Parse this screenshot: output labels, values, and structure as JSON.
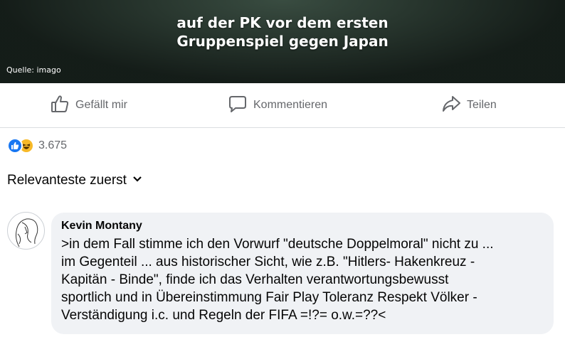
{
  "post_image": {
    "caption_line1": "auf der PK vor dem ersten",
    "caption_line2": "Gruppenspiel gegen Japan",
    "source": "Quelle: imago"
  },
  "actions": {
    "like": "Gefällt mir",
    "comment": "Kommentieren",
    "share": "Teilen"
  },
  "reactions": {
    "count": "3.675",
    "types": [
      "like",
      "haha"
    ]
  },
  "sort": {
    "label": "Relevanteste zuerst"
  },
  "comment": {
    "author": "Kevin Montany",
    "text": ">in dem Fall stimme ich den Vorwurf \"deutsche Doppelmoral\" nicht zu ...\nim Gegenteil ... aus historischer Sicht, wie z.B. \"Hitlers- Hakenkreuz -\nKapitän - Binde\", finde ich das Verhalten verantwortungsbewusst\nsportlich und in Übereinstimmung Fair Play Toleranz Respekt Völker -\nVerständigung i.c. und Regeln der FIFA =!?= o.w.=??<"
  },
  "colors": {
    "accent_blue": "#1877f2",
    "haha_yellow": "#f7b928",
    "secondary_text": "#65676b",
    "bubble_bg": "#f0f2f5"
  }
}
